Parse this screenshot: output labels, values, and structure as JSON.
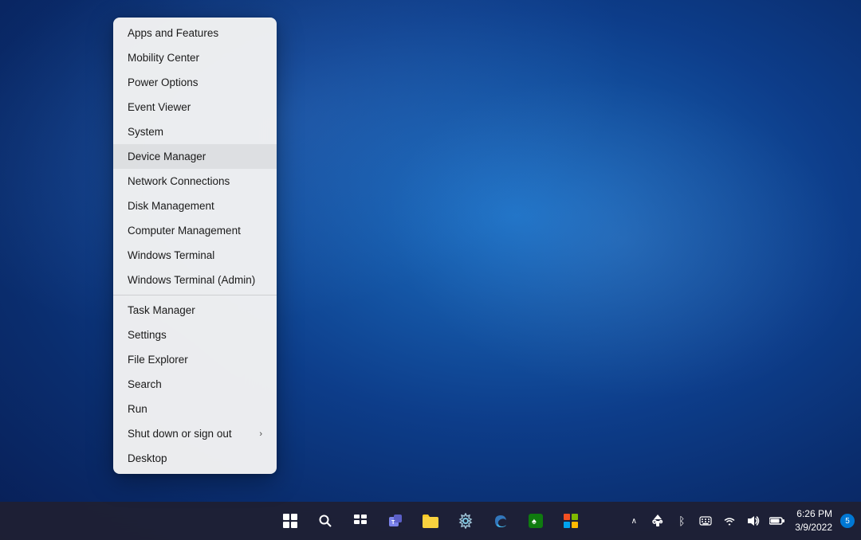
{
  "desktop": {
    "background_description": "Windows 11 blue desktop"
  },
  "context_menu": {
    "items": [
      {
        "id": "apps-features",
        "label": "Apps and Features",
        "separator_after": false
      },
      {
        "id": "mobility-center",
        "label": "Mobility Center",
        "separator_after": false
      },
      {
        "id": "power-options",
        "label": "Power Options",
        "separator_after": false
      },
      {
        "id": "event-viewer",
        "label": "Event Viewer",
        "separator_after": false
      },
      {
        "id": "system",
        "label": "System",
        "separator_after": false
      },
      {
        "id": "device-manager",
        "label": "Device Manager",
        "separator_after": false,
        "highlighted": true
      },
      {
        "id": "network-connections",
        "label": "Network Connections",
        "separator_after": false
      },
      {
        "id": "disk-management",
        "label": "Disk Management",
        "separator_after": false
      },
      {
        "id": "computer-management",
        "label": "Computer Management",
        "separator_after": false
      },
      {
        "id": "windows-terminal",
        "label": "Windows Terminal",
        "separator_after": false
      },
      {
        "id": "windows-terminal-admin",
        "label": "Windows Terminal (Admin)",
        "separator_after": true
      },
      {
        "id": "task-manager",
        "label": "Task Manager",
        "separator_after": false
      },
      {
        "id": "settings",
        "label": "Settings",
        "separator_after": false
      },
      {
        "id": "file-explorer",
        "label": "File Explorer",
        "separator_after": false
      },
      {
        "id": "search",
        "label": "Search",
        "separator_after": false
      },
      {
        "id": "run",
        "label": "Run",
        "separator_after": false
      },
      {
        "id": "shut-down",
        "label": "Shut down or sign out",
        "separator_after": false,
        "has_arrow": true
      },
      {
        "id": "desktop",
        "label": "Desktop",
        "separator_after": false
      }
    ]
  },
  "taskbar": {
    "icons": [
      {
        "id": "start",
        "symbol": "⊞",
        "label": "Start"
      },
      {
        "id": "search",
        "symbol": "⌕",
        "label": "Search"
      },
      {
        "id": "task-view",
        "symbol": "❑",
        "label": "Task View"
      },
      {
        "id": "teams",
        "symbol": "👥",
        "label": "Microsoft Teams"
      },
      {
        "id": "file-explorer",
        "symbol": "📁",
        "label": "File Explorer"
      },
      {
        "id": "settings-gear",
        "symbol": "⚙",
        "label": "Settings"
      },
      {
        "id": "edge",
        "symbol": "◎",
        "label": "Microsoft Edge"
      },
      {
        "id": "solitaire",
        "symbol": "♠",
        "label": "Microsoft Solitaire"
      },
      {
        "id": "store",
        "symbol": "⬛",
        "label": "Microsoft Store"
      }
    ],
    "tray": {
      "chevron": "∧",
      "usb": "⏻",
      "bluetooth": "ᛒ",
      "keyboard": "⌨",
      "wifi": "WiFi",
      "volume": "🔊",
      "battery": "🔋"
    },
    "clock": {
      "time": "6:26 PM",
      "date": "3/9/2022"
    },
    "notification_count": "5"
  }
}
